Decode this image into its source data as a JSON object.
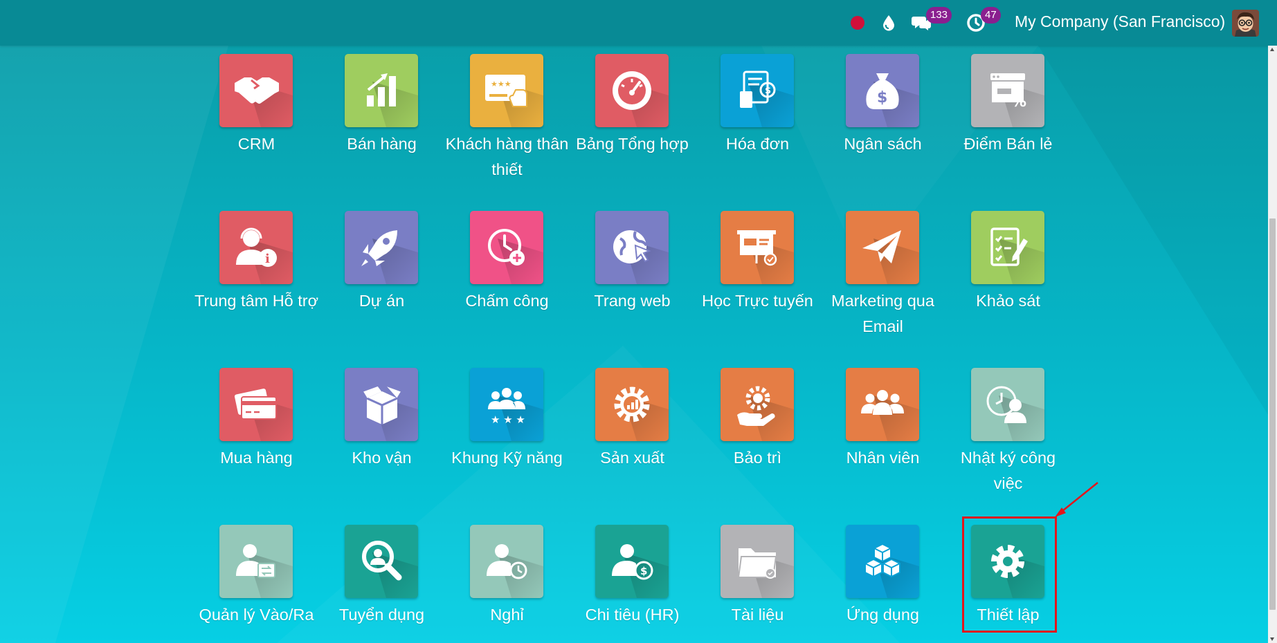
{
  "header": {
    "company": "My Company (San Francisco)",
    "messages_count": "133",
    "activities_count": "47"
  },
  "apps": [
    {
      "label": "CRM",
      "icon": "handshake-icon",
      "color": "#e05c64"
    },
    {
      "label": "Bán hàng",
      "icon": "bar-chart-icon",
      "color": "#9fcd5f"
    },
    {
      "label": "Khách hàng thân thiết",
      "icon": "loyalty-card-icon",
      "color": "#eab03f"
    },
    {
      "label": "Bảng Tổng hợp",
      "icon": "gauge-icon",
      "color": "#e05c64"
    },
    {
      "label": "Hóa đơn",
      "icon": "invoice-icon",
      "color": "#0aa1d6"
    },
    {
      "label": "Ngân sách",
      "icon": "money-bag-icon",
      "color": "#7a7ec5"
    },
    {
      "label": "Điểm Bán lẻ",
      "icon": "shop-icon",
      "color": "#b3b3b6"
    },
    {
      "label": "Trung tâm Hỗ trợ",
      "icon": "helpdesk-icon",
      "color": "#e05c64"
    },
    {
      "label": "Dự án",
      "icon": "rocket-icon",
      "color": "#7a7ec5"
    },
    {
      "label": "Chấm công",
      "icon": "timesheet-clock-icon",
      "color": "#f05287"
    },
    {
      "label": "Trang web",
      "icon": "globe-cursor-icon",
      "color": "#7a7ec5"
    },
    {
      "label": "Học Trực tuyến",
      "icon": "presentation-icon",
      "color": "#e57d45"
    },
    {
      "label": "Marketing qua Email",
      "icon": "paper-plane-icon",
      "color": "#e57d45"
    },
    {
      "label": "Khảo sát",
      "icon": "survey-icon",
      "color": "#9fcd5f"
    },
    {
      "label": "Mua hàng",
      "icon": "credit-card-icon",
      "color": "#e05c64"
    },
    {
      "label": "Kho vận",
      "icon": "box-icon",
      "color": "#7a7ec5"
    },
    {
      "label": "Khung Kỹ năng",
      "icon": "team-stars-icon",
      "color": "#0aa1d6"
    },
    {
      "label": "Sản xuất",
      "icon": "gear-chart-icon",
      "color": "#e57d45"
    },
    {
      "label": "Bảo trì",
      "icon": "maintenance-icon",
      "color": "#e57d45"
    },
    {
      "label": "Nhân viên",
      "icon": "employees-icon",
      "color": "#e57d45"
    },
    {
      "label": "Nhật ký công việc",
      "icon": "clock-person-icon",
      "color": "#94c8b9"
    },
    {
      "label": "Quản lý Vào/Ra",
      "icon": "attendance-icon",
      "color": "#94c8b9"
    },
    {
      "label": "Tuyển dụng",
      "icon": "magnifier-person-icon",
      "color": "#1aa394"
    },
    {
      "label": "Nghỉ",
      "icon": "time-off-icon",
      "color": "#94c8b9"
    },
    {
      "label": "Chi tiêu (HR)",
      "icon": "expense-icon",
      "color": "#1aa394"
    },
    {
      "label": "Tài liệu",
      "icon": "folder-icon",
      "color": "#b3b3b6"
    },
    {
      "label": "Ứng dụng",
      "icon": "cubes-icon",
      "color": "#0aa1d6"
    },
    {
      "label": "Thiết lập",
      "icon": "settings-gear-icon",
      "color": "#1aa394"
    }
  ],
  "annotation": {
    "highlight_color": "#e4151b"
  }
}
